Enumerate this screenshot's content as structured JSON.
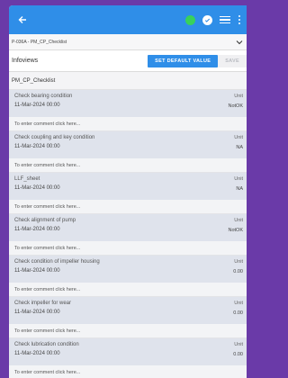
{
  "appbar": {
    "back_icon": "arrow-left-icon",
    "status_color": "#38d15a"
  },
  "subheader": {
    "asset_title": "P-036A - PM_CP_Checklist"
  },
  "infobar": {
    "title": "Infoviews",
    "primary_button": "SET DEFAULT VALUE",
    "secondary_button": "SAVE"
  },
  "section": {
    "title": "PM_CP_Checklist"
  },
  "items": [
    {
      "name": "Check bearing condition",
      "date": "11-Mar-2024 00:00",
      "unit": "Unit",
      "value": "NotOK",
      "comment": "To enter comment click here..."
    },
    {
      "name": "Check coupling and key condition",
      "date": "11-Mar-2024 00:00",
      "unit": "Unit",
      "value": "NA",
      "comment": "To enter comment click here..."
    },
    {
      "name": "LLF_sheet",
      "date": "11-Mar-2024 00:00",
      "unit": "Unit",
      "value": "NA",
      "comment": "To enter comment click here..."
    },
    {
      "name": "Check alignment of pump",
      "date": "11-Mar-2024 00:00",
      "unit": "Unit",
      "value": "NotOK",
      "comment": "To enter comment click here..."
    },
    {
      "name": "Check condition of impeller housing",
      "date": "11-Mar-2024 00:00",
      "unit": "Unit",
      "value": "0.00",
      "comment": "To enter comment click here..."
    },
    {
      "name": "Check impeller for wear",
      "date": "11-Mar-2024 00:00",
      "unit": "Unit",
      "value": "0.00",
      "comment": "To enter comment click here..."
    },
    {
      "name": "Check lubrication condition",
      "date": "11-Mar-2024 00:00",
      "unit": "Unit",
      "value": "0.00",
      "comment": "To enter comment click here..."
    }
  ]
}
